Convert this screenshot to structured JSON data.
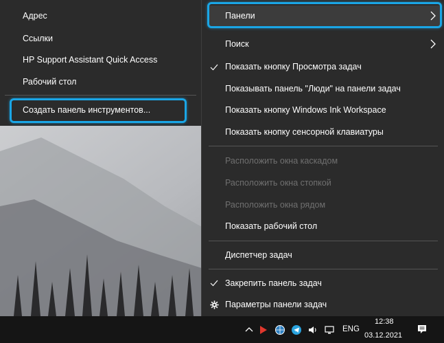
{
  "submenu": {
    "items": [
      {
        "label": "Адрес"
      },
      {
        "label": "Ссылки"
      },
      {
        "label": "HP Support Assistant Quick Access"
      },
      {
        "label": "Рабочий стол"
      }
    ],
    "create_toolbar_label": "Создать панель инструментов..."
  },
  "context_menu": {
    "panels_label": "Панели",
    "search_label": "Поиск",
    "show_task_view_label": "Показать кнопку Просмотра задач",
    "show_people_label": "Показывать панель \"Люди\" на панели задач",
    "show_ink_label": "Показать кнопку Windows Ink Workspace",
    "show_touch_keyboard_label": "Показать кнопку сенсорной клавиатуры",
    "cascade_label": "Расположить окна каскадом",
    "stack_label": "Расположить окна стопкой",
    "side_by_side_label": "Расположить окна рядом",
    "show_desktop_label": "Показать рабочий стол",
    "task_manager_label": "Диспетчер задач",
    "lock_taskbar_label": "Закрепить панель задач",
    "taskbar_settings_label": "Параметры панели задач"
  },
  "taskbar": {
    "language": "ENG",
    "time": "12:38",
    "date": "03.12.2021"
  },
  "colors": {
    "menu_bg": "#2b2b2b",
    "highlight": "#1aa6e6",
    "disabled_text": "#707070"
  }
}
